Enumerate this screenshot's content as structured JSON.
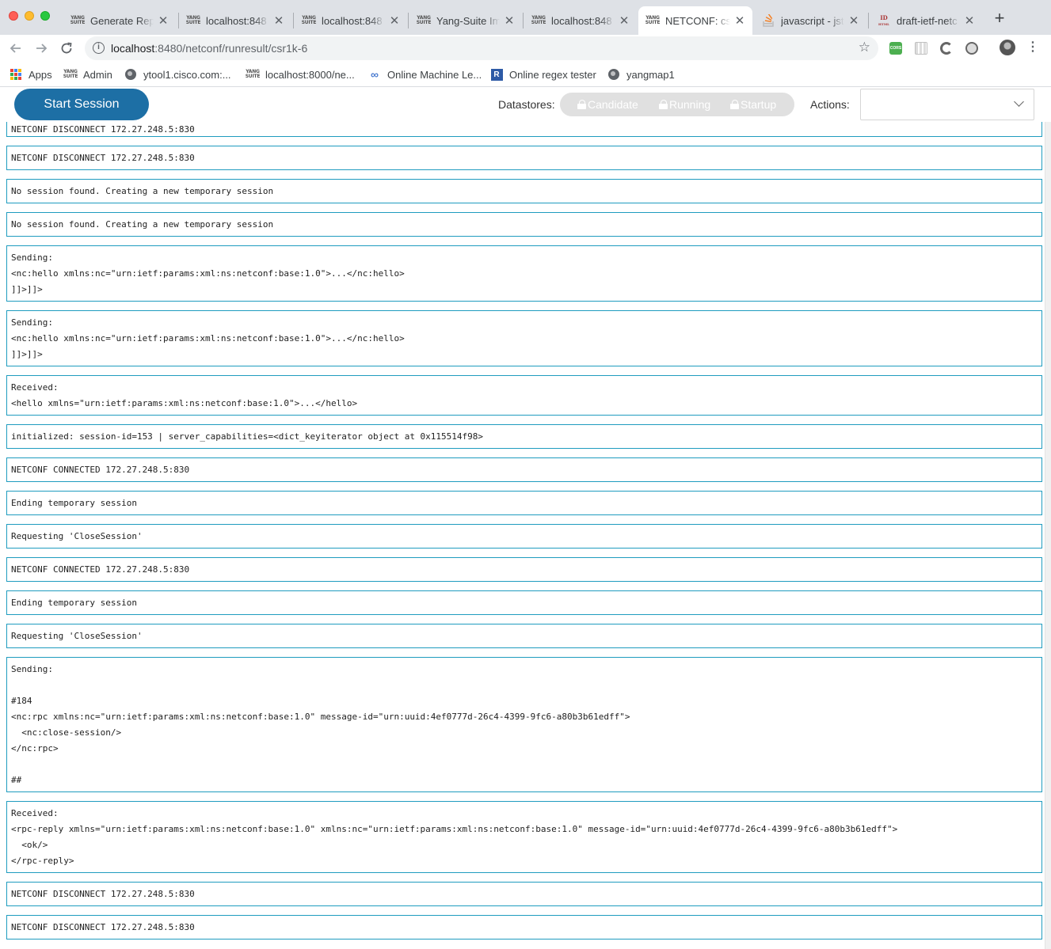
{
  "browser": {
    "tabs": [
      {
        "title": "Generate Repl",
        "favicon": "yang-suite-icon",
        "active": false
      },
      {
        "title": "localhost:848",
        "favicon": "yang-suite-icon",
        "active": false
      },
      {
        "title": "localhost:848",
        "favicon": "yang-suite-icon",
        "active": false
      },
      {
        "title": "Yang-Suite Im",
        "favicon": "yang-suite-icon",
        "active": false
      },
      {
        "title": "localhost:848",
        "favicon": "yang-suite-icon",
        "active": false
      },
      {
        "title": "NETCONF: csr",
        "favicon": "yang-suite-icon",
        "active": true
      },
      {
        "title": "javascript - jst",
        "favicon": "stackoverflow-icon",
        "active": false
      },
      {
        "title": "draft-ietf-netc",
        "favicon": "ietf-icon",
        "active": false
      }
    ],
    "favicon_text": {
      "yang_line1": "YANG",
      "yang_line2": "SUITE",
      "ietf_line1": "ID",
      "ietf_line2": "HTML"
    },
    "close_glyph": "✕",
    "new_tab_glyph": "+",
    "url_host": "localhost",
    "url_rest": ":8480/netconf/runresult/csr1k-6",
    "bookmarks": [
      {
        "label": "Apps",
        "icon": "apps-grid-icon"
      },
      {
        "label": "Admin",
        "icon": "yang-suite-icon"
      },
      {
        "label": "ytool1.cisco.com:...",
        "icon": "globe-icon"
      },
      {
        "label": "localhost:8000/ne...",
        "icon": "yang-suite-icon"
      },
      {
        "label": "Online Machine Le...",
        "icon": "infinity-icon"
      },
      {
        "label": "Online regex tester",
        "icon": "regex-icon"
      },
      {
        "label": "yangmap1",
        "icon": "globe-icon"
      }
    ],
    "regex_icon_letter": "R",
    "cors_ext_label": "CORS"
  },
  "header": {
    "start_session_label": "Start Session",
    "datastores_label": "Datastores:",
    "datastores": [
      "Candidate",
      "Running",
      "Startup"
    ],
    "actions_label": "Actions:",
    "actions_value": ""
  },
  "log": [
    "NETCONF DISCONNECT 172.27.248.5:830",
    "NETCONF DISCONNECT 172.27.248.5:830",
    "No session found. Creating a new temporary session",
    "No session found. Creating a new temporary session",
    "Sending:\n<nc:hello xmlns:nc=\"urn:ietf:params:xml:ns:netconf:base:1.0\">...</nc:hello>\n]]>]]>",
    "Sending:\n<nc:hello xmlns:nc=\"urn:ietf:params:xml:ns:netconf:base:1.0\">...</nc:hello>\n]]>]]>",
    "Received:\n<hello xmlns=\"urn:ietf:params:xml:ns:netconf:base:1.0\">...</hello>",
    "initialized: session-id=153 | server_capabilities=<dict_keyiterator object at 0x115514f98>",
    "NETCONF CONNECTED 172.27.248.5:830",
    "Ending temporary session",
    "Requesting 'CloseSession'",
    "NETCONF CONNECTED 172.27.248.5:830",
    "Ending temporary session",
    "Requesting 'CloseSession'",
    "Sending:\n\n#184\n<nc:rpc xmlns:nc=\"urn:ietf:params:xml:ns:netconf:base:1.0\" message-id=\"urn:uuid:4ef0777d-26c4-4399-9fc6-a80b3b61edff\">\n  <nc:close-session/>\n</nc:rpc>\n\n##",
    "Received:\n<rpc-reply xmlns=\"urn:ietf:params:xml:ns:netconf:base:1.0\" xmlns:nc=\"urn:ietf:params:xml:ns:netconf:base:1.0\" message-id=\"urn:uuid:4ef0777d-26c4-4399-9fc6-a80b3b61edff\">\n  <ok/>\n</rpc-reply>",
    "NETCONF DISCONNECT 172.27.248.5:830",
    "NETCONF DISCONNECT 172.27.248.5:830"
  ],
  "colors": {
    "accent": "#1d6fa5",
    "log_border": "#1f9cbf",
    "datastore_pill": "#e0e0e0"
  }
}
